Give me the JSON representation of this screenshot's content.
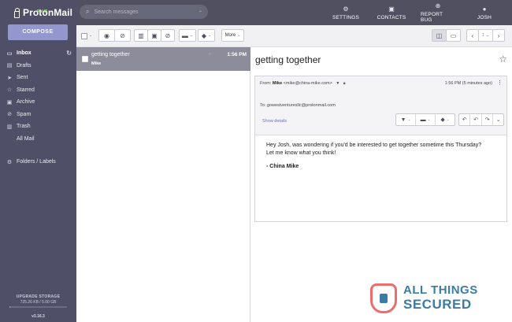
{
  "app": {
    "brand": "ProtonMail",
    "brand_tag": "PLUS",
    "compose_label": "COMPOSE",
    "storage_label": "UPGRADE STORAGE",
    "storage_value": "725.26 KB / 5.00 GB",
    "storage_fraction": 0.0001,
    "version": "v3.16.3"
  },
  "sidebar": {
    "items": [
      {
        "label": "Inbox",
        "icon": "inbox-icon"
      },
      {
        "label": "Drafts",
        "icon": "drafts-icon"
      },
      {
        "label": "Sent",
        "icon": "sent-icon"
      },
      {
        "label": "Starred",
        "icon": "star-icon"
      },
      {
        "label": "Archive",
        "icon": "archive-icon"
      },
      {
        "label": "Spam",
        "icon": "spam-icon"
      },
      {
        "label": "Trash",
        "icon": "trash-icon"
      },
      {
        "label": "All Mail",
        "icon": ""
      },
      {
        "label": "Folders / Labels",
        "icon": "gear-icon"
      }
    ]
  },
  "header": {
    "search_placeholder": "Search messages",
    "nav": [
      {
        "label": "SETTINGS",
        "icon": "settings-icon"
      },
      {
        "label": "CONTACTS",
        "icon": "contacts-icon"
      },
      {
        "label": "REPORT BUG",
        "icon": "globe-icon"
      },
      {
        "label": "JOSH",
        "icon": "user-icon"
      }
    ]
  },
  "toolbar": {
    "more_label": "More",
    "page_indicator": "1"
  },
  "message_list": [
    {
      "subject": "getting together",
      "sender": "Mike",
      "time": "1:56 PM"
    }
  ],
  "message": {
    "title": "getting together",
    "from_label": "From:",
    "from_name": "Mike",
    "from_email": "<mike@china-mike.com>",
    "time": "1:56 PM (5 minutes ago)",
    "to_label": "To:",
    "to_email": "gowestventuresllc@protonmail.com",
    "show_details": "Show details",
    "body_line1": "Hey Josh, was wondering if you'd be interested to get together sometime this Thursday?",
    "body_line2": "Let me know what you think!",
    "signature": "- China Mike"
  },
  "watermark": {
    "line1": "ALL THINGS",
    "line2": "SECURED"
  },
  "colors": {
    "sidebar_bg": "#4f5068",
    "topbar_bg": "#505061",
    "compose_bg": "#9397cd",
    "selected_row": "#8c8c9a",
    "link": "#6b6fb6"
  }
}
